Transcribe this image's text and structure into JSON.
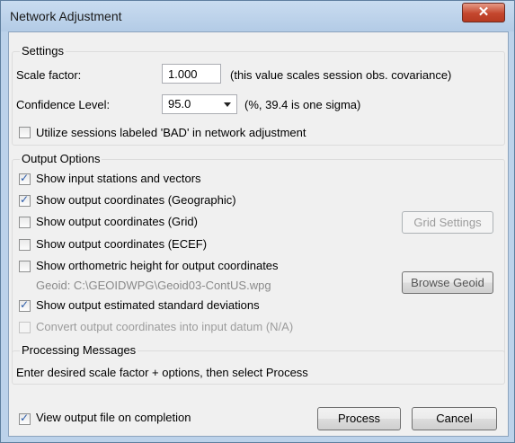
{
  "window": {
    "title": "Network Adjustment",
    "close_glyph": "✕"
  },
  "settings": {
    "legend": "Settings",
    "scale_label": "Scale factor:",
    "scale_value": "1.000",
    "scale_note": "(this value scales session obs. covariance)",
    "confidence_label": "Confidence Level:",
    "confidence_value": "95.0",
    "confidence_note": "(%, 39.4 is one sigma)",
    "bad_sessions_label": "Utilize sessions labeled 'BAD' in network adjustment",
    "bad_sessions_checked": false
  },
  "output": {
    "legend": "Output Options",
    "opt_input_label": "Show input stations and vectors",
    "opt_geographic_label": "Show output coordinates (Geographic)",
    "opt_grid_label": "Show output coordinates (Grid)",
    "opt_ecef_label": "Show output coordinates (ECEF)",
    "opt_ortho_label": "Show orthometric height for output coordinates",
    "geoid_path": "Geoid: C:\\GEOIDWPG\\Geoid03-ContUS.wpg",
    "opt_stddev_label": "Show output estimated standard deviations",
    "opt_convert_label": "Convert output coordinates into input datum (N/A)",
    "grid_settings_button": "Grid Settings",
    "browse_geoid_button": "Browse Geoid",
    "checked": {
      "input": true,
      "geographic": true,
      "grid": false,
      "ecef": false,
      "ortho": false,
      "stddev": true,
      "convert": false
    }
  },
  "messages": {
    "legend": "Processing Messages",
    "text": "Enter desired scale factor + options, then select Process"
  },
  "footer": {
    "view_output_label": "View output file on completion",
    "view_output_checked": true,
    "process_button": "Process",
    "cancel_button": "Cancel"
  }
}
